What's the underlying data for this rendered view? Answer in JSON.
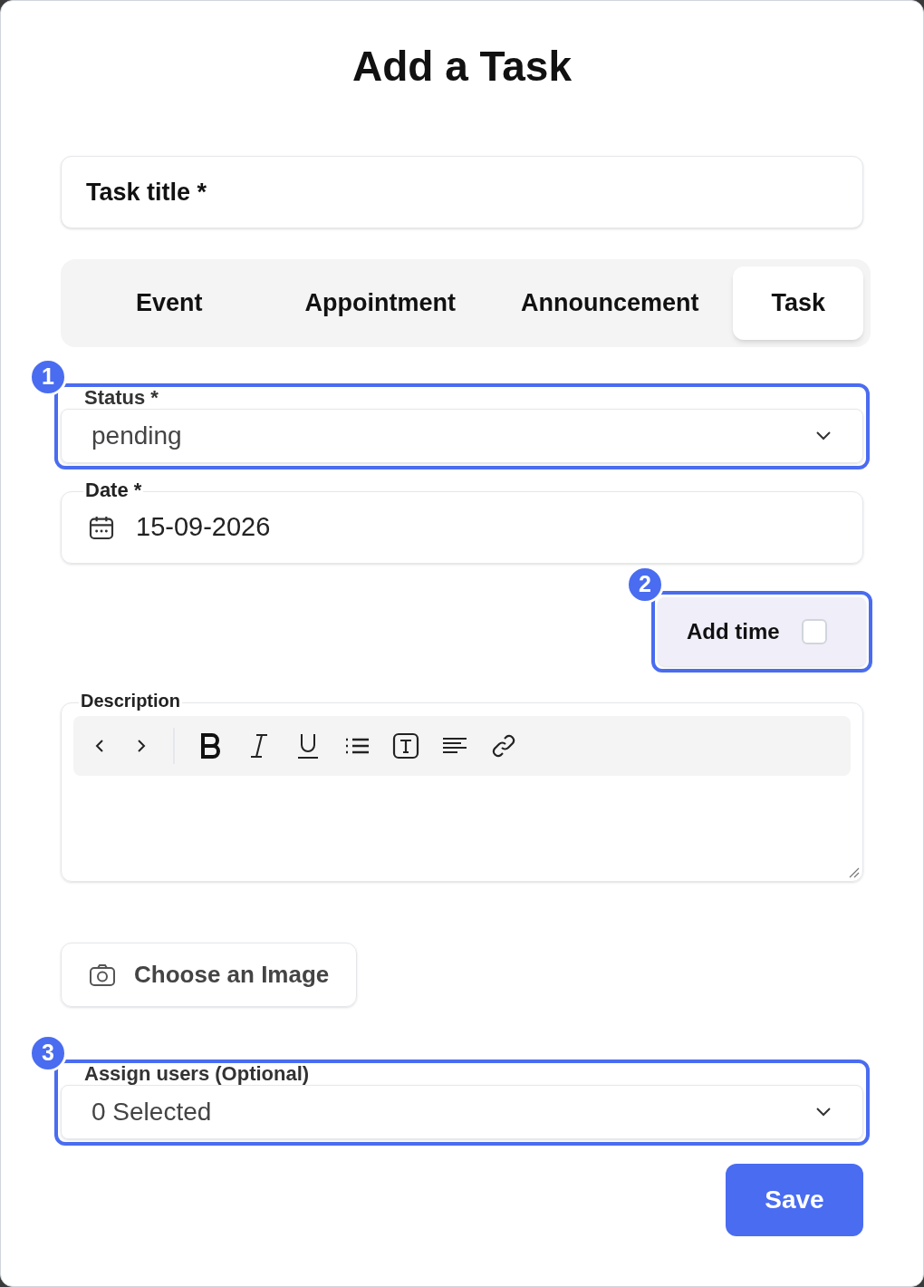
{
  "title": "Add a Task",
  "task_title": {
    "placeholder": "Task title *"
  },
  "tabs": [
    {
      "label": "Event",
      "selected": false
    },
    {
      "label": "Appointment",
      "selected": false
    },
    {
      "label": "Announcement",
      "selected": false
    },
    {
      "label": "Task",
      "selected": true
    }
  ],
  "status": {
    "badge": "1",
    "label": "Status *",
    "value": "pending"
  },
  "date": {
    "label": "Date *",
    "value": "15-09-2026"
  },
  "add_time": {
    "badge": "2",
    "label": "Add time",
    "checked": false
  },
  "description": {
    "label": "Description"
  },
  "image_button": "Choose an Image",
  "assign": {
    "badge": "3",
    "label": "Assign users (Optional)",
    "value": "0 Selected"
  },
  "save_button": "Save"
}
